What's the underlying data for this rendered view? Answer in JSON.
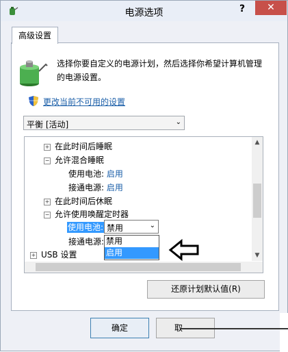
{
  "window": {
    "title": "电源选项",
    "help_label": "?",
    "close_label": "✕"
  },
  "tab": {
    "label": "高级设置"
  },
  "description": "选择你要自定义的电源计划，然后选择你希望计算机管理的电源设置。",
  "change_link": "更改当前不可用的设置",
  "plan_select": {
    "value": "平衡 [活动]"
  },
  "tree": {
    "items": [
      {
        "expander": "+",
        "label": "在此时间后睡眠"
      },
      {
        "expander": "−",
        "label": "允许混合睡眠"
      },
      {
        "label": "使用电池:",
        "value": "启用"
      },
      {
        "label": "接通电源:",
        "value": "启用"
      },
      {
        "expander": "+",
        "label": "在此时间后休眠"
      },
      {
        "expander": "−",
        "label": "允许使用唤醒定时器"
      },
      {
        "label": "使用电池:",
        "value": "禁用"
      },
      {
        "label": "接通电源:",
        "value": ""
      },
      {
        "expander": "+",
        "label": "USB 设置"
      }
    ]
  },
  "dropdown": {
    "selected": "禁用",
    "options": [
      "禁用",
      "启用"
    ],
    "highlighted_index": 1
  },
  "restore_button": "还原计划默认值(R)",
  "ok_button": "确定",
  "cancel_button": "取"
}
